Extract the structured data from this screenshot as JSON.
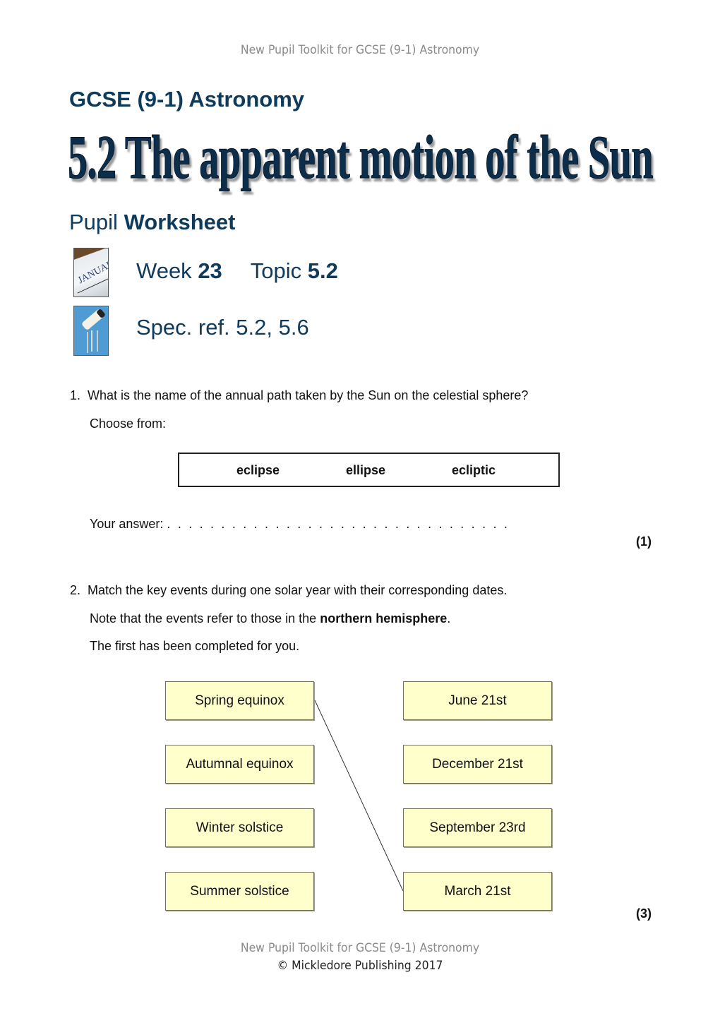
{
  "header": {
    "running_title": "New Pupil Toolkit for GCSE (9-1) Astronomy"
  },
  "title_block": {
    "course": "GCSE (9-1) Astronomy",
    "main_title": "5.2 The apparent motion of the Sun",
    "worksheet_prefix": "Pupil",
    "worksheet_bold": "Worksheet",
    "week_label": "Week",
    "week_value": "23",
    "topic_label": "Topic",
    "topic_value": "5.2",
    "spec_ref": "Spec. ref. 5.2, 5.6",
    "icons": {
      "calendar": "calendar-icon",
      "textbook": "textbook-cover-icon",
      "calendar_text": "JANUARY"
    }
  },
  "question1": {
    "number": "1.",
    "text": "What is the name of the annual path taken by the Sun on the celestial sphere?",
    "choose_label": "Choose from:",
    "choices": [
      "eclipse",
      "ellipse",
      "ecliptic"
    ],
    "answer_label": "Your answer:",
    "answer_value": "",
    "answer_dots": ". . . . . . . . . . . . . . . . . . . . . . . . . . . . . . . .",
    "marks": "(1)"
  },
  "question2": {
    "number": "2.",
    "text": "Match the key events during one solar year with their corresponding dates.",
    "note_prefix": "Note that the events refer to those in the ",
    "note_bold": "northern hemisphere",
    "note_suffix": ".",
    "first_done": "The first has been completed for you.",
    "events": [
      "Spring equinox",
      "Autumnal equinox",
      "Winter solstice",
      "Summer solstice"
    ],
    "dates": [
      "June 21st",
      "December 21st",
      "September 23rd",
      "March 21st"
    ],
    "completed_matches": [
      {
        "event": "Spring equinox",
        "date": "March 21st"
      }
    ],
    "box_color": "#ffffcc",
    "marks": "(3)"
  },
  "footer": {
    "line1": "New Pupil Toolkit for GCSE (9-1) Astronomy",
    "line2": "© Mickledore Publishing 2017"
  },
  "colors": {
    "heading_blue": "#0e3a5c",
    "title_navy": "#0c2e4a",
    "header_grey": "#8a8a8a"
  }
}
